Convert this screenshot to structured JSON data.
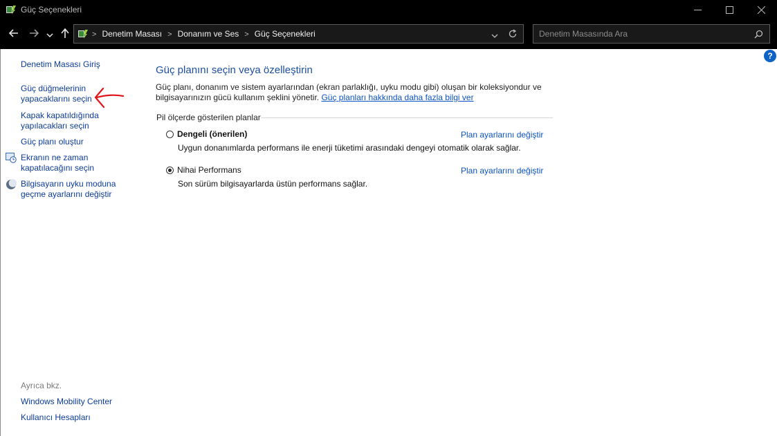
{
  "window": {
    "title": "Güç Seçenekleri"
  },
  "breadcrumb": {
    "items": [
      "Denetim Masası",
      "Donanım ve Ses",
      "Güç Seçenekleri"
    ]
  },
  "search": {
    "placeholder": "Denetim Masasında Ara"
  },
  "sidebar": {
    "home": "Denetim Masası Giriş",
    "links": [
      "Güç düğmelerinin yapacaklarını seçin",
      "Kapak kapatıldığında yapılacakları seçin",
      "Güç planı oluştur",
      "Ekranın ne zaman kapatılacağını seçin",
      "Bilgisayarın uyku moduna geçme ayarlarını değiştir"
    ],
    "see_also_label": "Ayrıca bkz.",
    "see_also": [
      "Windows Mobility Center",
      "Kullanıcı Hesapları"
    ]
  },
  "main": {
    "title": "Güç planını seçin veya özelleştirin",
    "description": "Güç planı, donanım ve sistem ayarlarından (ekran parlaklığı, uyku modu gibi) oluşan bir koleksiyondur ve bilgisayarınızın gücü kullanım şeklini yönetir.",
    "description_link": "Güç planları hakkında daha fazla bilgi ver",
    "section_label": "Pil ölçerde gösterilen planlar",
    "plans": [
      {
        "name": "Dengeli (önerilen)",
        "description": "Uygun donanımlarda performans ile enerji tüketimi arasındaki dengeyi otomatik olarak sağlar.",
        "link": "Plan ayarlarını değiştir",
        "selected": false
      },
      {
        "name": "Nihai Performans",
        "description": "Son sürüm bilgisayarlarda üstün performans sağlar.",
        "link": "Plan ayarlarını değiştir",
        "selected": true
      }
    ]
  },
  "help": {
    "label": "?"
  },
  "colors": {
    "link": "#0b3b99",
    "title": "#1d4fa1",
    "chrome": "#000000",
    "annotation": "#e0161b"
  }
}
